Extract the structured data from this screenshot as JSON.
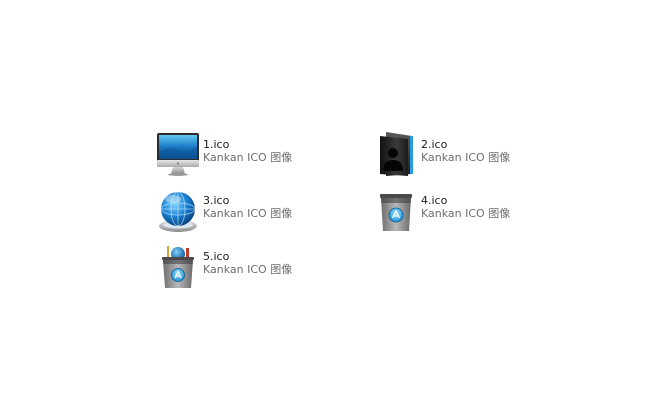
{
  "files": [
    {
      "name": "1.ico",
      "type": "Kankan ICO 图像",
      "icon": "imac-monitor-icon"
    },
    {
      "name": "2.ico",
      "type": "Kankan ICO 图像",
      "icon": "dark-user-folder-icon"
    },
    {
      "name": "3.ico",
      "type": "Kankan ICO 图像",
      "icon": "blue-globe-icon"
    },
    {
      "name": "4.ico",
      "type": "Kankan ICO 图像",
      "icon": "app-store-box-icon"
    },
    {
      "name": "5.ico",
      "type": "Kankan ICO 图像",
      "icon": "app-store-box-with-items-icon"
    }
  ],
  "colors": {
    "background": "#ffffff",
    "name_text": "#1a1a1a",
    "type_text": "#6d6d6d",
    "accent_blue": "#2a9be0"
  }
}
